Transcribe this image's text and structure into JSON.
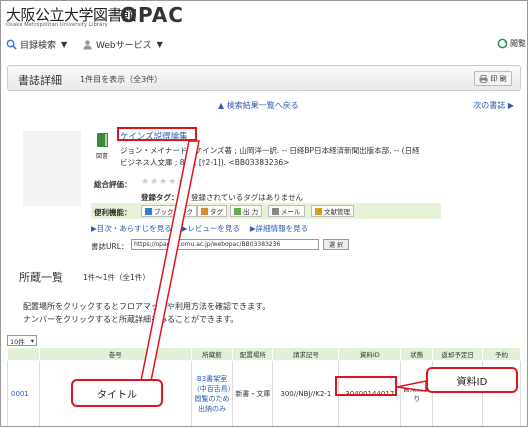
{
  "header": {
    "logo_jp": "大阪公立大学図書館",
    "logo_en": "Osaka Metropolitan University Library",
    "logo_opac": "OPAC"
  },
  "nav": {
    "catalog_search": "目録検索",
    "web_services": "Webサービス",
    "right_label": "閲覧"
  },
  "title_bar": {
    "title": "書誌詳細",
    "count": "1件目を表示（全3件）",
    "print_label": "印 刷"
  },
  "links": {
    "back": "▲ 検索結果一覧へ戻る",
    "next": "次の書誌 ▶"
  },
  "record": {
    "type_label": "図書",
    "title": "ケインズ説得論集",
    "desc_line1": "ジョン・メイナード・ケインズ著 ; 山岡洋一訳. -- 日経BP日本経済新聞出版本部, -- (日経",
    "desc_line2": "ビジネス人文庫 ; 814, [ｹ2-1]). <BB03383236>",
    "rating_label": "総合評価：",
    "stars": "★★★★★",
    "tag_label": "登録タグ：",
    "tag_text": "登録されているタグはありません"
  },
  "functions": {
    "label": "便利機能：",
    "bookmark": "ブックマーク",
    "tag": "タグ",
    "output": "出 力",
    "mail": "メール",
    "literature": "文献管理"
  },
  "sub_links": {
    "toc": "▶目次・あらすじを見る",
    "review": "▶レビューを見る",
    "detail": "▶詳細情報を見る"
  },
  "url": {
    "label": "書誌URL：",
    "value": "https://opac.ao.omu.ac.jp/webopac/BB03383236",
    "button": "選 択"
  },
  "holdings": {
    "title": "所蔵一覧",
    "count": "1件～1件（全1件）",
    "note_line1": "配置場所をクリックするとフロアマップや利用方法を確認できます。",
    "note_line2": "ナンバーをクリックすると所蔵詳細をみることができます。",
    "per_page": "10件",
    "columns": [
      "",
      "巻号",
      "所蔵館",
      "配置場所",
      "請求記号",
      "資料ID",
      "状態",
      "返却予定日",
      "予約"
    ],
    "rows": [
      {
        "num": "0001",
        "volume": "",
        "library": "B3書架室（中百舌鳥）閲覧のため出納のみ",
        "location": "新書・文庫",
        "call_no": "300//NBJ//K2-1",
        "item_id": "30400144017",
        "status": "書架にあり",
        "due": "",
        "reserve": ""
      }
    ]
  },
  "annotations": {
    "title_callout": "タイトル",
    "id_callout": "資料ID"
  },
  "colors": {
    "accent_red": "#e0141e",
    "link_blue": "#2a5db0",
    "table_header_green": "#e3f0d8",
    "function_bar_green": "#e6f3d9"
  }
}
